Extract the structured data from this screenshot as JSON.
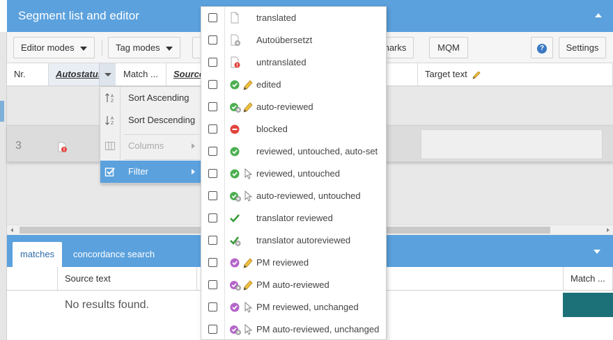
{
  "segment_panel": {
    "title": "Segment list and editor"
  },
  "toolbar": {
    "editor_modes": "Editor modes",
    "tag_modes": "Tag modes",
    "marks": "marks",
    "mqm": "MQM",
    "help": "?",
    "settings": "Settings"
  },
  "grid": {
    "columns": [
      "Nr.",
      "Autostatus",
      "Match ...",
      "Source",
      "Target text"
    ],
    "row": {
      "number": "3"
    }
  },
  "column_menu": {
    "sort_ascending": "Sort Ascending",
    "sort_descending": "Sort Descending",
    "columns": "Columns",
    "filter": "Filter"
  },
  "filter_menu": {
    "items": [
      {
        "label": "translated",
        "icons": [
          "page"
        ]
      },
      {
        "label": "Autoübersetzt",
        "icons": [
          "page-gear"
        ]
      },
      {
        "label": "untranslated",
        "icons": [
          "page-red"
        ]
      },
      {
        "label": "edited",
        "icons": [
          "green-check",
          "pencil"
        ]
      },
      {
        "label": "auto-reviewed",
        "icons": [
          "green-check-gear",
          "pencil"
        ]
      },
      {
        "label": "blocked",
        "icons": [
          "red-minus"
        ]
      },
      {
        "label": "reviewed, untouched, auto-set",
        "icons": [
          "green-check"
        ]
      },
      {
        "label": "reviewed, untouched",
        "icons": [
          "green-check",
          "cursor"
        ]
      },
      {
        "label": "auto-reviewed, untouched",
        "icons": [
          "green-check-gear",
          "cursor"
        ]
      },
      {
        "label": "translator reviewed",
        "icons": [
          "tick"
        ]
      },
      {
        "label": "translator autoreviewed",
        "icons": [
          "tick-gear"
        ]
      },
      {
        "label": "PM reviewed",
        "icons": [
          "purple-check",
          "pencil"
        ]
      },
      {
        "label": "PM auto-reviewed",
        "icons": [
          "purple-check-gear",
          "pencil"
        ]
      },
      {
        "label": "PM reviewed, unchanged",
        "icons": [
          "purple-check",
          "cursor"
        ]
      },
      {
        "label": "PM auto-reviewed, unchanged",
        "icons": [
          "purple-check-gear",
          "cursor"
        ]
      }
    ]
  },
  "bottom_panel": {
    "tabs": [
      "matches",
      "concordance search"
    ],
    "columns": [
      "Source text",
      "Match ..."
    ],
    "empty_text": "No results found."
  },
  "colors": {
    "header_blue": "#5ba1dd",
    "status_green": "#4caf50",
    "status_red": "#e0443c",
    "status_purple": "#b565c9",
    "match_teal": "#1b7177"
  }
}
